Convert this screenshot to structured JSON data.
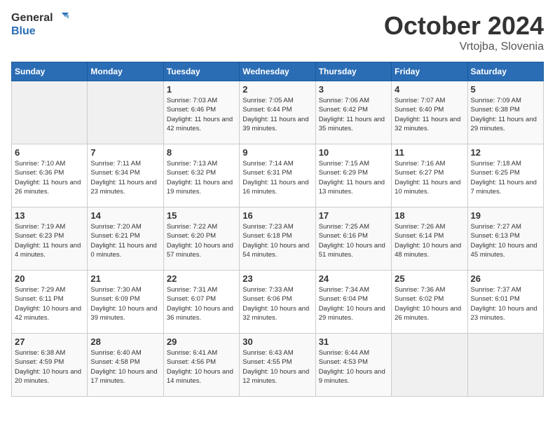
{
  "header": {
    "logo_general": "General",
    "logo_blue": "Blue",
    "month": "October 2024",
    "location": "Vrtojba, Slovenia"
  },
  "days_of_week": [
    "Sunday",
    "Monday",
    "Tuesday",
    "Wednesday",
    "Thursday",
    "Friday",
    "Saturday"
  ],
  "weeks": [
    [
      {
        "day": "",
        "info": ""
      },
      {
        "day": "",
        "info": ""
      },
      {
        "day": "1",
        "info": "Sunrise: 7:03 AM\nSunset: 6:46 PM\nDaylight: 11 hours and 42 minutes."
      },
      {
        "day": "2",
        "info": "Sunrise: 7:05 AM\nSunset: 6:44 PM\nDaylight: 11 hours and 39 minutes."
      },
      {
        "day": "3",
        "info": "Sunrise: 7:06 AM\nSunset: 6:42 PM\nDaylight: 11 hours and 35 minutes."
      },
      {
        "day": "4",
        "info": "Sunrise: 7:07 AM\nSunset: 6:40 PM\nDaylight: 11 hours and 32 minutes."
      },
      {
        "day": "5",
        "info": "Sunrise: 7:09 AM\nSunset: 6:38 PM\nDaylight: 11 hours and 29 minutes."
      }
    ],
    [
      {
        "day": "6",
        "info": "Sunrise: 7:10 AM\nSunset: 6:36 PM\nDaylight: 11 hours and 26 minutes."
      },
      {
        "day": "7",
        "info": "Sunrise: 7:11 AM\nSunset: 6:34 PM\nDaylight: 11 hours and 23 minutes."
      },
      {
        "day": "8",
        "info": "Sunrise: 7:13 AM\nSunset: 6:32 PM\nDaylight: 11 hours and 19 minutes."
      },
      {
        "day": "9",
        "info": "Sunrise: 7:14 AM\nSunset: 6:31 PM\nDaylight: 11 hours and 16 minutes."
      },
      {
        "day": "10",
        "info": "Sunrise: 7:15 AM\nSunset: 6:29 PM\nDaylight: 11 hours and 13 minutes."
      },
      {
        "day": "11",
        "info": "Sunrise: 7:16 AM\nSunset: 6:27 PM\nDaylight: 11 hours and 10 minutes."
      },
      {
        "day": "12",
        "info": "Sunrise: 7:18 AM\nSunset: 6:25 PM\nDaylight: 11 hours and 7 minutes."
      }
    ],
    [
      {
        "day": "13",
        "info": "Sunrise: 7:19 AM\nSunset: 6:23 PM\nDaylight: 11 hours and 4 minutes."
      },
      {
        "day": "14",
        "info": "Sunrise: 7:20 AM\nSunset: 6:21 PM\nDaylight: 11 hours and 0 minutes."
      },
      {
        "day": "15",
        "info": "Sunrise: 7:22 AM\nSunset: 6:20 PM\nDaylight: 10 hours and 57 minutes."
      },
      {
        "day": "16",
        "info": "Sunrise: 7:23 AM\nSunset: 6:18 PM\nDaylight: 10 hours and 54 minutes."
      },
      {
        "day": "17",
        "info": "Sunrise: 7:25 AM\nSunset: 6:16 PM\nDaylight: 10 hours and 51 minutes."
      },
      {
        "day": "18",
        "info": "Sunrise: 7:26 AM\nSunset: 6:14 PM\nDaylight: 10 hours and 48 minutes."
      },
      {
        "day": "19",
        "info": "Sunrise: 7:27 AM\nSunset: 6:13 PM\nDaylight: 10 hours and 45 minutes."
      }
    ],
    [
      {
        "day": "20",
        "info": "Sunrise: 7:29 AM\nSunset: 6:11 PM\nDaylight: 10 hours and 42 minutes."
      },
      {
        "day": "21",
        "info": "Sunrise: 7:30 AM\nSunset: 6:09 PM\nDaylight: 10 hours and 39 minutes."
      },
      {
        "day": "22",
        "info": "Sunrise: 7:31 AM\nSunset: 6:07 PM\nDaylight: 10 hours and 36 minutes."
      },
      {
        "day": "23",
        "info": "Sunrise: 7:33 AM\nSunset: 6:06 PM\nDaylight: 10 hours and 32 minutes."
      },
      {
        "day": "24",
        "info": "Sunrise: 7:34 AM\nSunset: 6:04 PM\nDaylight: 10 hours and 29 minutes."
      },
      {
        "day": "25",
        "info": "Sunrise: 7:36 AM\nSunset: 6:02 PM\nDaylight: 10 hours and 26 minutes."
      },
      {
        "day": "26",
        "info": "Sunrise: 7:37 AM\nSunset: 6:01 PM\nDaylight: 10 hours and 23 minutes."
      }
    ],
    [
      {
        "day": "27",
        "info": "Sunrise: 6:38 AM\nSunset: 4:59 PM\nDaylight: 10 hours and 20 minutes."
      },
      {
        "day": "28",
        "info": "Sunrise: 6:40 AM\nSunset: 4:58 PM\nDaylight: 10 hours and 17 minutes."
      },
      {
        "day": "29",
        "info": "Sunrise: 6:41 AM\nSunset: 4:56 PM\nDaylight: 10 hours and 14 minutes."
      },
      {
        "day": "30",
        "info": "Sunrise: 6:43 AM\nSunset: 4:55 PM\nDaylight: 10 hours and 12 minutes."
      },
      {
        "day": "31",
        "info": "Sunrise: 6:44 AM\nSunset: 4:53 PM\nDaylight: 10 hours and 9 minutes."
      },
      {
        "day": "",
        "info": ""
      },
      {
        "day": "",
        "info": ""
      }
    ]
  ]
}
